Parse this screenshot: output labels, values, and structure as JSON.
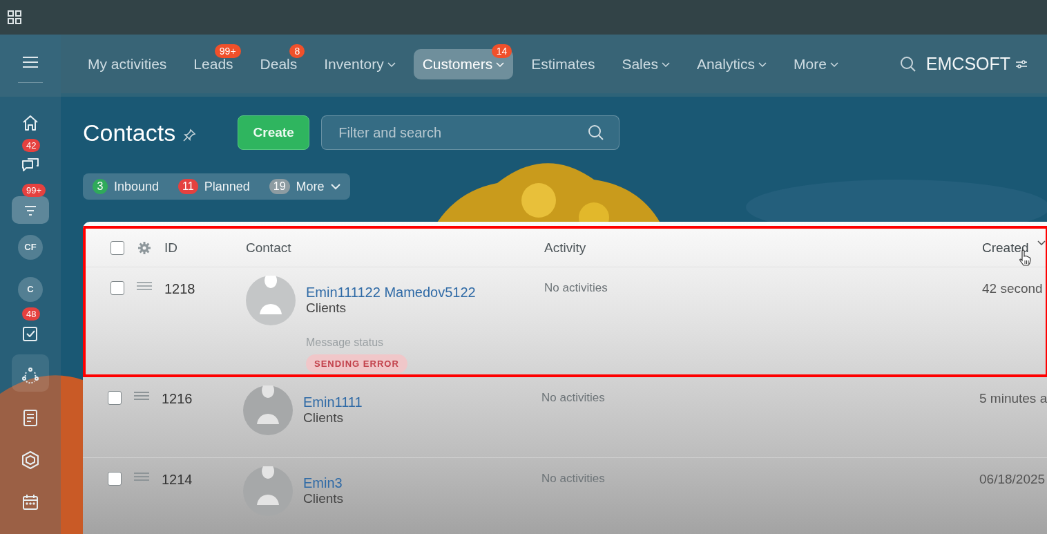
{
  "sidebar": {
    "items": [
      {
        "kind": "icon",
        "selected": false
      },
      {
        "kind": "icon",
        "badge": "42",
        "selected": false
      },
      {
        "kind": "icon",
        "badge": "99+",
        "selected": true
      },
      {
        "kind": "initials",
        "label": "CF"
      },
      {
        "kind": "initials",
        "label": "C"
      },
      {
        "kind": "icon",
        "badge": "48",
        "selected": false
      },
      {
        "kind": "icon",
        "selected": false
      },
      {
        "kind": "icon",
        "selected": false
      },
      {
        "kind": "icon",
        "selected": false
      },
      {
        "kind": "icon",
        "selected": false
      }
    ]
  },
  "nav": {
    "items": [
      {
        "label": "My activities",
        "dropdown": false,
        "selected": false
      },
      {
        "label": "Leads",
        "badge": "99+",
        "dropdown": false,
        "selected": false
      },
      {
        "label": "Deals",
        "badge": "8",
        "dropdown": false,
        "selected": false
      },
      {
        "label": "Inventory",
        "dropdown": true,
        "selected": false
      },
      {
        "label": "Customers",
        "badge": "14",
        "dropdown": true,
        "selected": true
      },
      {
        "label": "Estimates",
        "dropdown": false,
        "selected": false
      },
      {
        "label": "Sales",
        "dropdown": true,
        "selected": false
      },
      {
        "label": "Analytics",
        "dropdown": true,
        "selected": false
      },
      {
        "label": "More",
        "dropdown": true,
        "selected": false
      }
    ],
    "brand": "EMCSOFT"
  },
  "page": {
    "title": "Contacts",
    "create": "Create",
    "search": {
      "placeholder": "Filter and search"
    },
    "counters": [
      {
        "count": "3",
        "label": "Inbound",
        "color": "#2faa5a"
      },
      {
        "count": "11",
        "label": "Planned",
        "color": "#e5413f"
      },
      {
        "count": "19",
        "label": "More",
        "color": "#8d9ca2"
      }
    ]
  },
  "table": {
    "select_all": {
      "checked": false
    },
    "columns": [
      {
        "label": "ID",
        "sorted": false
      },
      {
        "label": "Contact",
        "sorted": false
      },
      {
        "label": "Activity",
        "sorted": false
      },
      {
        "label": "Created",
        "sorted": true
      }
    ],
    "rows": [
      {
        "id": "1218",
        "name": "Emin111122 Mamedov5122",
        "type": "Clients",
        "activity": "No activities",
        "created": "42 second",
        "checked": false,
        "message_status": {
          "label": "Message status",
          "status": "SENDING ERROR"
        }
      },
      {
        "id": "1216",
        "name": "Emin1111",
        "type": "Clients",
        "activity": "No activities",
        "created": "5 minutes a",
        "checked": false
      },
      {
        "id": "1214",
        "name": "Emin3",
        "type": "Clients",
        "activity": "No activities",
        "created": "06/18/2025",
        "checked": false
      }
    ]
  }
}
